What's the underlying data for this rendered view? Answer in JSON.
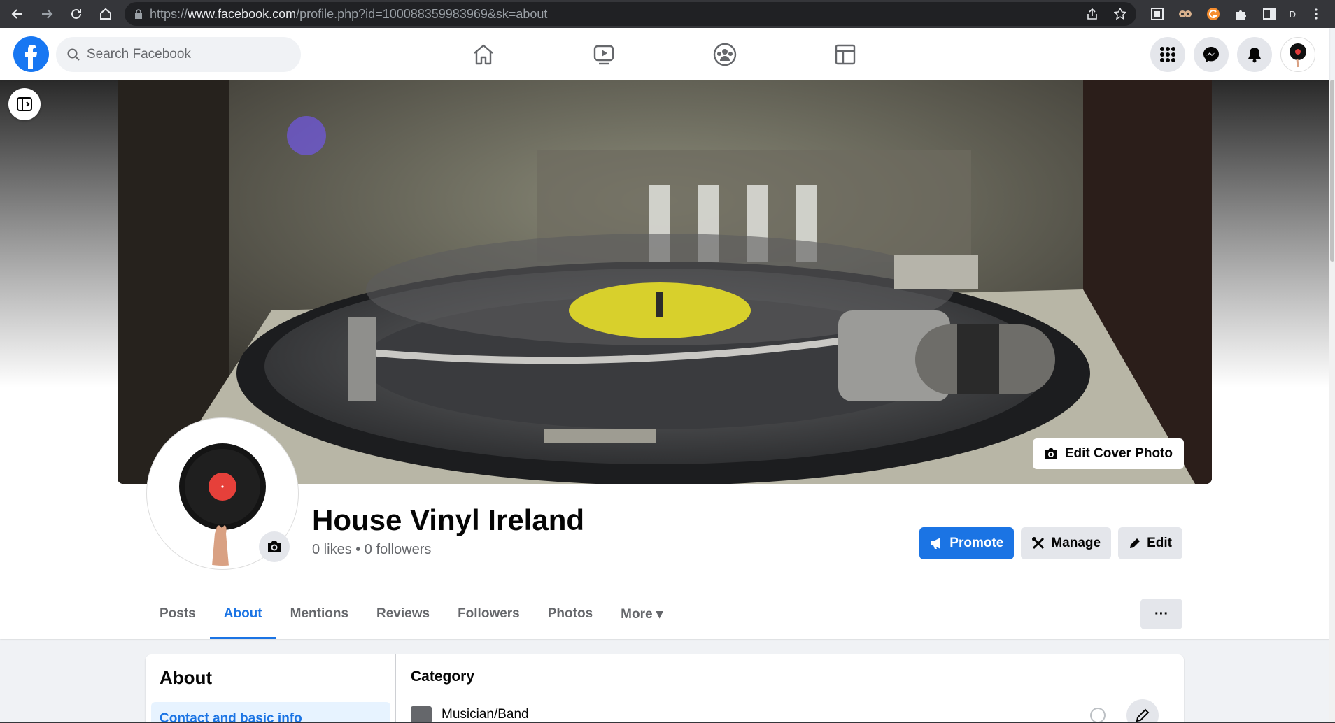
{
  "browser": {
    "url_prefix": "https://",
    "url_domain": "www.facebook.com",
    "url_path": "/profile.php?id=100088359983969&sk=about",
    "profile_initial": "D"
  },
  "header": {
    "search_placeholder": "Search Facebook"
  },
  "cover": {
    "edit_label": "Edit Cover Photo"
  },
  "page": {
    "name": "House Vinyl Ireland",
    "stats": "0 likes • 0 followers"
  },
  "actions": {
    "promote": "Promote",
    "manage": "Manage",
    "edit": "Edit",
    "more": "···"
  },
  "tabs": [
    {
      "label": "Posts",
      "active": false
    },
    {
      "label": "About",
      "active": true
    },
    {
      "label": "Mentions",
      "active": false
    },
    {
      "label": "Reviews",
      "active": false
    },
    {
      "label": "Followers",
      "active": false
    },
    {
      "label": "Photos",
      "active": false
    },
    {
      "label": "More ▾",
      "active": false
    }
  ],
  "about": {
    "title": "About",
    "link": "Contact and basic info",
    "category_title": "Category",
    "category_value": "Musician/Band"
  },
  "colors": {
    "brand": "#1877f2",
    "accent": "#1b74e4",
    "chrome": "#35363a"
  }
}
